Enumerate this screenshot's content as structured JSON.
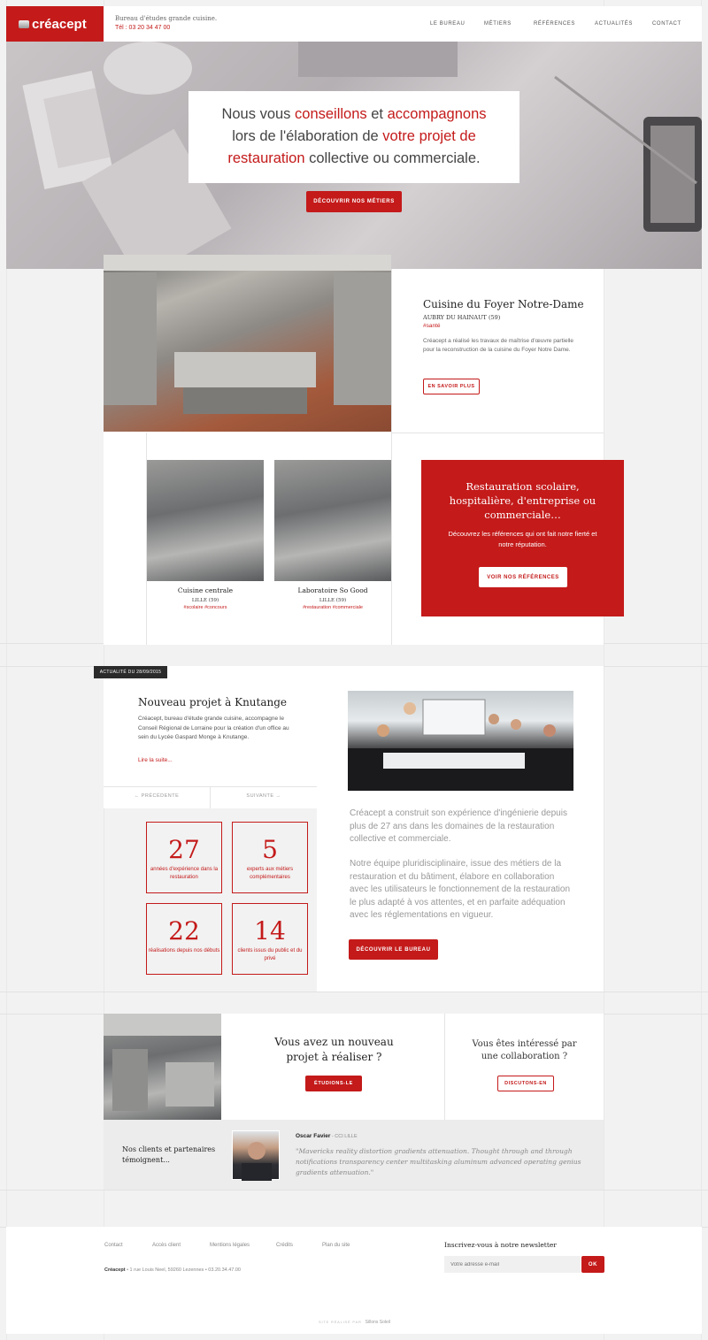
{
  "header": {
    "logo_text": "créacept",
    "tagline": "Bureau d'études grande cuisine.",
    "phone": "Tél : 03 20 34 47 00",
    "nav": [
      "LE BUREAU",
      "MÉTIERS",
      "RÉFÉRENCES",
      "ACTUALITÉS",
      "CONTACT"
    ]
  },
  "hero": {
    "line1_a": "Nous vous ",
    "line1_b": "conseillons",
    "line1_c": " et ",
    "line1_d": "accompagnons",
    "line2_a": "lors de l'élaboration de ",
    "line2_b": "votre projet de",
    "line3_a": "restauration",
    "line3_b": " collective ou commerciale.",
    "cta": "DÉCOUVRIR NOS MÉTIERS"
  },
  "featured": {
    "title": "Cuisine du Foyer Notre-Dame",
    "location": "AUBRY DU HAINAUT (59)",
    "tag": "#santé",
    "description": "Créacept a réalisé les travaux de maîtrise d'œuvre partielle pour la reconstruction de la cuisine du Foyer Notre Dame.",
    "cta": "EN SAVOIR PLUS"
  },
  "projects": [
    {
      "title": "Cuisine centrale",
      "location": "LILLE (59)",
      "tags": "#scolaire #concours"
    },
    {
      "title": "Laboratoire So Good",
      "location": "LILLE (59)",
      "tags": "#restauration #commerciale"
    }
  ],
  "references_box": {
    "title": "Restauration scolaire, hospitalière, d'entreprise ou commerciale…",
    "text": "Découvrez les références qui ont fait notre fierté et notre réputation.",
    "cta": "VOIR NOS RÉFÉRENCES"
  },
  "news": {
    "badge": "ACTUALITÉ DU 28/09/2015",
    "title": "Nouveau projet à Knutange",
    "text": "Créacept, bureau d'étude grande cuisine, accompagne le Conseil Régional de Lorraine pour la création d'un office au sein du Lycée Gaspard Monge à Knutange.",
    "read_more": "Lire la suite...",
    "prev": "← PRÉCÉDENTE",
    "next": "SUIVANTE →"
  },
  "stats": [
    {
      "value": "27",
      "label": "années d'expérience dans la restauration"
    },
    {
      "value": "5",
      "label": "experts aux métiers complémentaires"
    },
    {
      "value": "22",
      "label": "réalisations depuis nos débuts"
    },
    {
      "value": "14",
      "label": "clients issus du public et du privé"
    }
  ],
  "about": {
    "p1": "Créacept a construit son expérience d'ingénierie depuis plus de 27 ans dans les domaines de la restauration collective et commerciale.",
    "p2": "Notre équipe pluridisciplinaire, issue des métiers de la restauration et du bâtiment, élabore en collaboration avec les utilisateurs le fonctionnement de la restauration le plus adapté à vos attentes, et en parfaite adéquation avec les réglementations en vigueur.",
    "cta": "DÉCOUVRIR LE BUREAU"
  },
  "contact_cta": {
    "project_title": "Vous avez un nouveau projet à réaliser ?",
    "project_btn": "ÉTUDIONS-LE",
    "collab_title": "Vous êtes intéressé par une collaboration ?",
    "collab_btn": "DISCUTONS-EN"
  },
  "testimonial": {
    "heading": "Nos clients et partenaires témoignent...",
    "name": "Oscar Favier",
    "company": " - CCI LILLE",
    "quote": "\"Mavericks reality distortion gradients attenuation. Thought through and through notifications transparency center multitasking aluminum advanced operating genius gradients attenuation.\""
  },
  "footer": {
    "links": [
      "Contact",
      "Accès client",
      "Mentions légales",
      "Crédits",
      "Plan du site"
    ],
    "company": "Créacept",
    "address": " • 1 rue Louis Neel, 59260 Lezennes • 03.20.34.47.00",
    "newsletter_title": "Inscrivez-vous à notre newsletter",
    "newsletter_placeholder": "Votre adresse e-mail",
    "newsletter_btn": "OK",
    "credit": "SITE RÉALISÉ PAR",
    "credit_brand": "Sillons Soleil"
  }
}
